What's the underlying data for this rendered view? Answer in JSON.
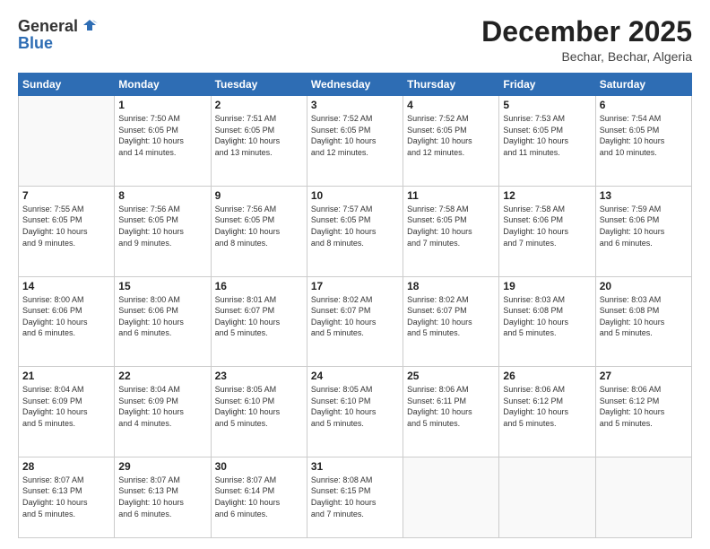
{
  "logo": {
    "general": "General",
    "blue": "Blue"
  },
  "header": {
    "title": "December 2025",
    "subtitle": "Bechar, Bechar, Algeria"
  },
  "weekdays": [
    "Sunday",
    "Monday",
    "Tuesday",
    "Wednesday",
    "Thursday",
    "Friday",
    "Saturday"
  ],
  "weeks": [
    [
      {
        "day": "",
        "info": ""
      },
      {
        "day": "1",
        "info": "Sunrise: 7:50 AM\nSunset: 6:05 PM\nDaylight: 10 hours\nand 14 minutes."
      },
      {
        "day": "2",
        "info": "Sunrise: 7:51 AM\nSunset: 6:05 PM\nDaylight: 10 hours\nand 13 minutes."
      },
      {
        "day": "3",
        "info": "Sunrise: 7:52 AM\nSunset: 6:05 PM\nDaylight: 10 hours\nand 12 minutes."
      },
      {
        "day": "4",
        "info": "Sunrise: 7:52 AM\nSunset: 6:05 PM\nDaylight: 10 hours\nand 12 minutes."
      },
      {
        "day": "5",
        "info": "Sunrise: 7:53 AM\nSunset: 6:05 PM\nDaylight: 10 hours\nand 11 minutes."
      },
      {
        "day": "6",
        "info": "Sunrise: 7:54 AM\nSunset: 6:05 PM\nDaylight: 10 hours\nand 10 minutes."
      }
    ],
    [
      {
        "day": "7",
        "info": "Sunrise: 7:55 AM\nSunset: 6:05 PM\nDaylight: 10 hours\nand 9 minutes."
      },
      {
        "day": "8",
        "info": "Sunrise: 7:56 AM\nSunset: 6:05 PM\nDaylight: 10 hours\nand 9 minutes."
      },
      {
        "day": "9",
        "info": "Sunrise: 7:56 AM\nSunset: 6:05 PM\nDaylight: 10 hours\nand 8 minutes."
      },
      {
        "day": "10",
        "info": "Sunrise: 7:57 AM\nSunset: 6:05 PM\nDaylight: 10 hours\nand 8 minutes."
      },
      {
        "day": "11",
        "info": "Sunrise: 7:58 AM\nSunset: 6:05 PM\nDaylight: 10 hours\nand 7 minutes."
      },
      {
        "day": "12",
        "info": "Sunrise: 7:58 AM\nSunset: 6:06 PM\nDaylight: 10 hours\nand 7 minutes."
      },
      {
        "day": "13",
        "info": "Sunrise: 7:59 AM\nSunset: 6:06 PM\nDaylight: 10 hours\nand 6 minutes."
      }
    ],
    [
      {
        "day": "14",
        "info": "Sunrise: 8:00 AM\nSunset: 6:06 PM\nDaylight: 10 hours\nand 6 minutes."
      },
      {
        "day": "15",
        "info": "Sunrise: 8:00 AM\nSunset: 6:06 PM\nDaylight: 10 hours\nand 6 minutes."
      },
      {
        "day": "16",
        "info": "Sunrise: 8:01 AM\nSunset: 6:07 PM\nDaylight: 10 hours\nand 5 minutes."
      },
      {
        "day": "17",
        "info": "Sunrise: 8:02 AM\nSunset: 6:07 PM\nDaylight: 10 hours\nand 5 minutes."
      },
      {
        "day": "18",
        "info": "Sunrise: 8:02 AM\nSunset: 6:07 PM\nDaylight: 10 hours\nand 5 minutes."
      },
      {
        "day": "19",
        "info": "Sunrise: 8:03 AM\nSunset: 6:08 PM\nDaylight: 10 hours\nand 5 minutes."
      },
      {
        "day": "20",
        "info": "Sunrise: 8:03 AM\nSunset: 6:08 PM\nDaylight: 10 hours\nand 5 minutes."
      }
    ],
    [
      {
        "day": "21",
        "info": "Sunrise: 8:04 AM\nSunset: 6:09 PM\nDaylight: 10 hours\nand 5 minutes."
      },
      {
        "day": "22",
        "info": "Sunrise: 8:04 AM\nSunset: 6:09 PM\nDaylight: 10 hours\nand 4 minutes."
      },
      {
        "day": "23",
        "info": "Sunrise: 8:05 AM\nSunset: 6:10 PM\nDaylight: 10 hours\nand 5 minutes."
      },
      {
        "day": "24",
        "info": "Sunrise: 8:05 AM\nSunset: 6:10 PM\nDaylight: 10 hours\nand 5 minutes."
      },
      {
        "day": "25",
        "info": "Sunrise: 8:06 AM\nSunset: 6:11 PM\nDaylight: 10 hours\nand 5 minutes."
      },
      {
        "day": "26",
        "info": "Sunrise: 8:06 AM\nSunset: 6:12 PM\nDaylight: 10 hours\nand 5 minutes."
      },
      {
        "day": "27",
        "info": "Sunrise: 8:06 AM\nSunset: 6:12 PM\nDaylight: 10 hours\nand 5 minutes."
      }
    ],
    [
      {
        "day": "28",
        "info": "Sunrise: 8:07 AM\nSunset: 6:13 PM\nDaylight: 10 hours\nand 5 minutes."
      },
      {
        "day": "29",
        "info": "Sunrise: 8:07 AM\nSunset: 6:13 PM\nDaylight: 10 hours\nand 6 minutes."
      },
      {
        "day": "30",
        "info": "Sunrise: 8:07 AM\nSunset: 6:14 PM\nDaylight: 10 hours\nand 6 minutes."
      },
      {
        "day": "31",
        "info": "Sunrise: 8:08 AM\nSunset: 6:15 PM\nDaylight: 10 hours\nand 7 minutes."
      },
      {
        "day": "",
        "info": ""
      },
      {
        "day": "",
        "info": ""
      },
      {
        "day": "",
        "info": ""
      }
    ]
  ]
}
